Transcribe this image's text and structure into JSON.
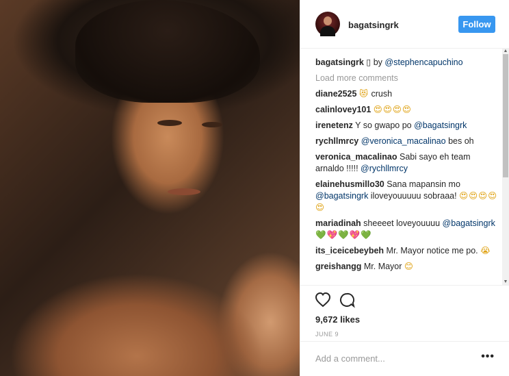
{
  "header": {
    "username": "bagatsingrk",
    "follow_label": "Follow"
  },
  "caption": {
    "username": "bagatsingrk",
    "glyph": "▯",
    "by_text": "by",
    "credit": "@stephencapuchino"
  },
  "load_more_label": "Load more comments",
  "comments": [
    {
      "user": "diane2525",
      "parts": [
        {
          "t": "emoji",
          "v": "😻"
        },
        {
          "t": "text",
          "v": " crush"
        }
      ]
    },
    {
      "user": "calinlovey101",
      "parts": [
        {
          "t": "emoji",
          "v": "😍😍😍😍"
        }
      ]
    },
    {
      "user": "irenetenz",
      "parts": [
        {
          "t": "text",
          "v": "Y so gwapo po "
        },
        {
          "t": "mention",
          "v": "@bagatsingrk"
        }
      ]
    },
    {
      "user": "rychllmrcy",
      "parts": [
        {
          "t": "mention",
          "v": "@veronica_macalinao"
        },
        {
          "t": "text",
          "v": " bes oh"
        }
      ]
    },
    {
      "user": "veronica_macalinao",
      "parts": [
        {
          "t": "text",
          "v": "Sabi sayo eh team arnaldo !!!!! "
        },
        {
          "t": "mention",
          "v": "@rychllmrcy"
        }
      ]
    },
    {
      "user": "elainehusmillo30",
      "parts": [
        {
          "t": "text",
          "v": "Sana mapansin mo "
        },
        {
          "t": "mention",
          "v": "@bagatsingrk"
        },
        {
          "t": "text",
          "v": " iloveyouuuuu sobraaa! "
        },
        {
          "t": "emoji",
          "v": "😍😍😍😍😍"
        }
      ]
    },
    {
      "user": "mariadinah",
      "parts": [
        {
          "t": "text",
          "v": "sheeeet loveyouuuu "
        },
        {
          "t": "mention",
          "v": "@bagatsingrk"
        },
        {
          "t": "text",
          "v": " "
        },
        {
          "t": "emoji",
          "v": "💚💖💚💖💚"
        }
      ]
    },
    {
      "user": "its_iceicebeybeh",
      "parts": [
        {
          "t": "text",
          "v": "Mr. Mayor notice me po. "
        },
        {
          "t": "emoji",
          "v": "😭"
        }
      ]
    },
    {
      "user": "greishangg",
      "parts": [
        {
          "t": "text",
          "v": "Mr. Mayor "
        },
        {
          "t": "emoji",
          "v": "😊"
        }
      ]
    }
  ],
  "actions": {
    "like_icon": "heart-icon",
    "comment_icon": "comment-icon",
    "likes": "9,672 likes",
    "date": "JUNE 9"
  },
  "add_comment": {
    "placeholder": "Add a comment...",
    "more_label": "•••"
  }
}
